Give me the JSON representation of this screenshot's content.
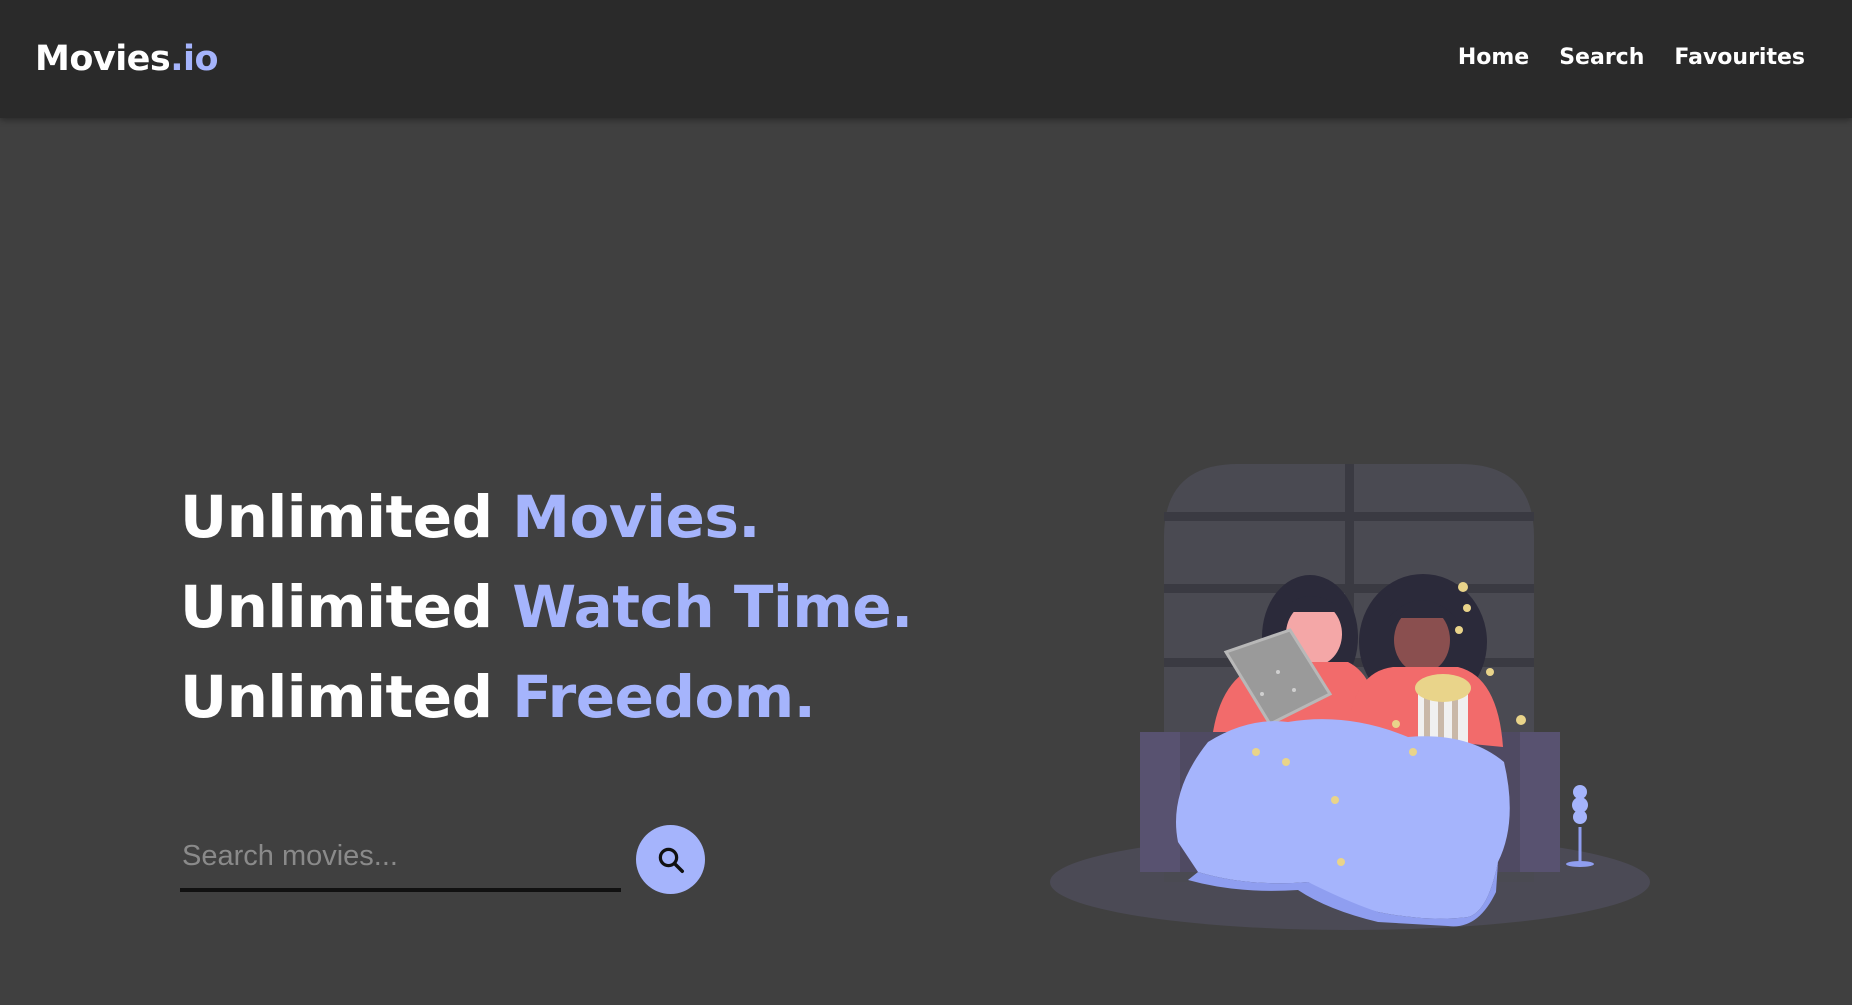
{
  "brand": {
    "name": "Movies",
    "suffix": ".io"
  },
  "nav": {
    "items": [
      {
        "label": "Home"
      },
      {
        "label": "Search"
      },
      {
        "label": "Favourites"
      }
    ]
  },
  "hero": {
    "lines": [
      {
        "prefix": "Unlimited",
        "highlight": "Movies."
      },
      {
        "prefix": "Unlimited",
        "highlight": "Watch Time."
      },
      {
        "prefix": "Unlimited",
        "highlight": "Freedom."
      }
    ]
  },
  "search": {
    "placeholder": "Search movies...",
    "value": "",
    "button_icon": "search-icon"
  },
  "illustration": {
    "icon": "couple-watching-movie-illustration"
  },
  "colors": {
    "navbar_bg": "#2a2a2a",
    "page_bg": "#404040",
    "accent": "#a5b4fc",
    "text": "#ffffff"
  }
}
